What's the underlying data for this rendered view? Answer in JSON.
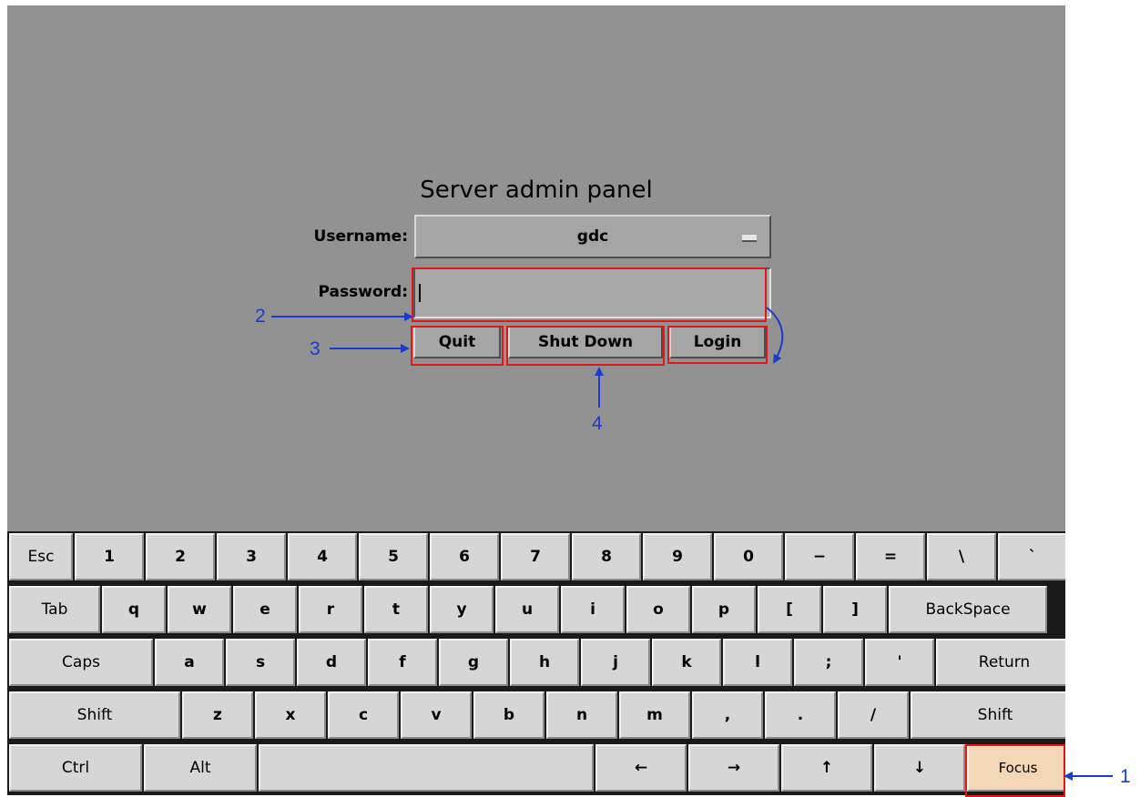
{
  "login": {
    "title": "Server admin panel",
    "username_label": "Username:",
    "username_value": "gdc",
    "password_label": "Password:",
    "password_value": ""
  },
  "buttons": {
    "quit": "Quit",
    "shutdown": "Shut Down",
    "login": "Login"
  },
  "annotations": {
    "a1": "1",
    "a2": "2",
    "a3": "3",
    "a4": "4",
    "color": "#1a3ccc",
    "highlight_color": "#e01818"
  },
  "keyboard": {
    "rows": [
      [
        "Esc",
        "1",
        "2",
        "3",
        "4",
        "5",
        "6",
        "7",
        "8",
        "9",
        "0",
        "−",
        "=",
        "\\",
        "`"
      ],
      [
        "Tab",
        "q",
        "w",
        "e",
        "r",
        "t",
        "y",
        "u",
        "i",
        "o",
        "p",
        "[",
        "]",
        "BackSpace"
      ],
      [
        "Caps",
        "a",
        "s",
        "d",
        "f",
        "g",
        "h",
        "j",
        "k",
        "l",
        ";",
        "'",
        "Return"
      ],
      [
        "Shift",
        "z",
        "x",
        "c",
        "v",
        "b",
        "n",
        "m",
        ",",
        ".",
        "/",
        "Shift"
      ],
      [
        "Ctrl",
        "Alt",
        "",
        "←",
        "→",
        "↑",
        "↓",
        "Focus"
      ]
    ]
  }
}
